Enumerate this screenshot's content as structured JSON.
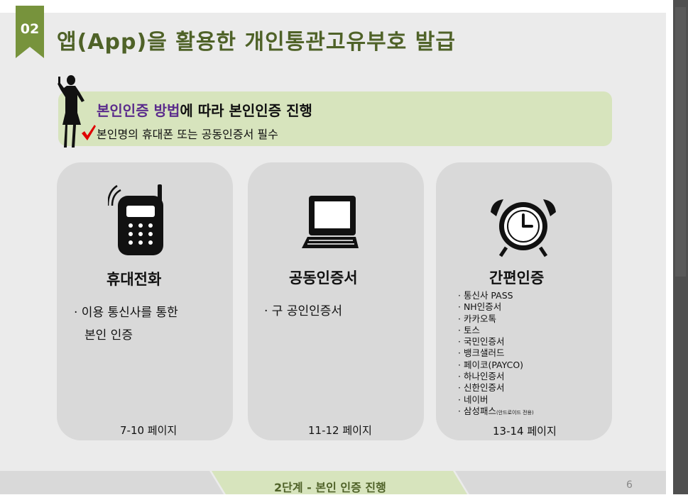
{
  "slide": {
    "badge": "02",
    "title": "앱(App)을 활용한 개인통관고유부호 발급"
  },
  "banner": {
    "highlight": "본인인증 방법",
    "line1_rest": "에 따라 본인인증 진행",
    "line2": "본인명의 휴대폰 또는 공동인증서 필수"
  },
  "cards": [
    {
      "icon": "mobile-phone-icon",
      "title": "휴대전화",
      "desc_line1": "· 이용 통신사를 통한",
      "desc_line2": "본인 인증",
      "pages": "7-10 페이지"
    },
    {
      "icon": "computer-icon",
      "title": "공동인증서",
      "desc_line1": "· 구 공인인증서",
      "pages": "11-12 페이지"
    },
    {
      "icon": "alarm-clock-icon",
      "title": "간편인증",
      "items": [
        "· 통신사 PASS",
        "· NH인증서",
        "· 카카오톡",
        "· 토스",
        "· 국민인증서",
        "· 뱅크샐러드",
        "· 페이코(PAYCO)",
        "· 하나인증서",
        "· 신한인증서",
        "· 네이버",
        "· 삼성패스"
      ],
      "last_item_note": "(안드로이드 전용)",
      "pages": "13-14 페이지"
    }
  ],
  "footer": {
    "step": "2단계 - 본인 인증 진행",
    "page_number": "6"
  },
  "colors": {
    "title_green": "#4f6228",
    "badge_green": "#77933c",
    "banner_bg": "#d7e4bd",
    "highlight_purple": "#5b2c8c",
    "card_bg": "#d9d9d9",
    "check_red": "#e00000"
  }
}
